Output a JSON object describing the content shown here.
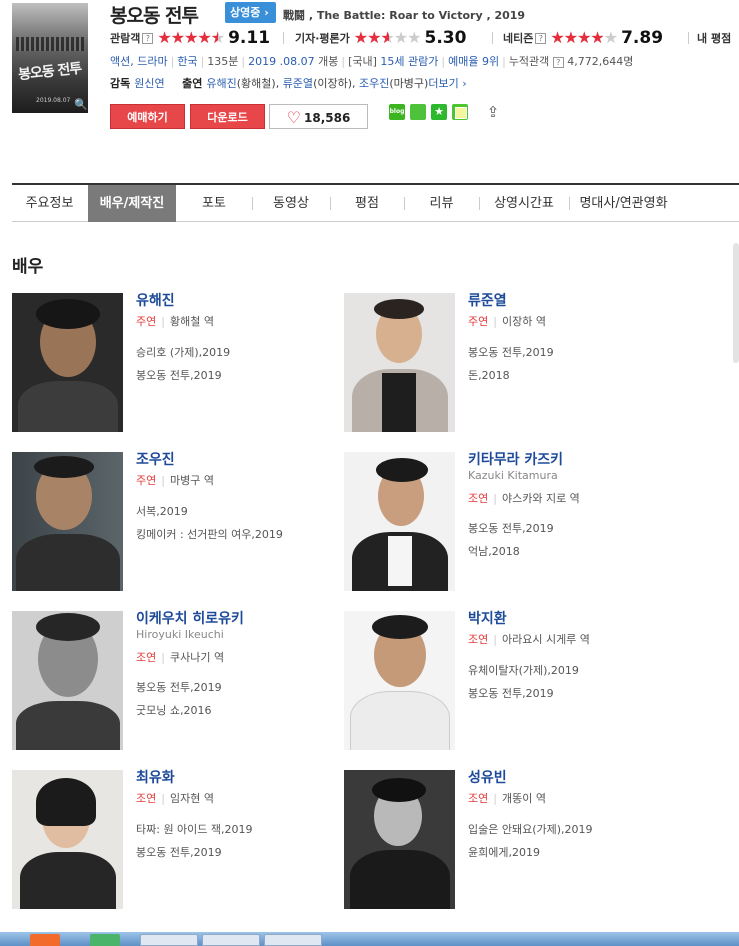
{
  "header": {
    "title": "봉오동 전투",
    "status_badge": "상영중",
    "subtitle": "戰鬪 , The Battle: Roar to Victory , 2019",
    "poster": {
      "title_text": "봉오동 전투",
      "date_text": "2019.08.07"
    },
    "ratings": [
      {
        "label": "관람객",
        "score": "9.11",
        "fill_percent": 91,
        "help": "?"
      },
      {
        "label": "기자·평론가",
        "score": "5.30",
        "fill_percent": 53,
        "help": ""
      },
      {
        "label": "네티즌",
        "score": "7.89",
        "fill_percent": 79,
        "help": "?"
      }
    ],
    "my_rating_label": "내 평점",
    "meta": {
      "genre": "액션, 드라마",
      "country": "한국",
      "runtime": "135분",
      "release_date": "2019 .08.07",
      "release_suffix": "개봉",
      "rating_prefix": "[국내]",
      "rating": "15세 관람가",
      "reservation": "예매율 9위",
      "audience_label": "누적관객",
      "audience_help": "?",
      "audience": "4,772,644명"
    },
    "credits": {
      "director_label": "감독",
      "director": "원신연",
      "cast_label": "출연",
      "cast": [
        {
          "name": "유해진",
          "role": "(황해철)"
        },
        {
          "name": "류준열",
          "role": "(이장하)"
        },
        {
          "name": "조우진",
          "role": "(마병구)"
        }
      ],
      "more_label": "더보기 ›"
    },
    "buttons": {
      "reserve": "예매하기",
      "download": "다운로드",
      "like_count": "18,586"
    },
    "sns": {
      "blog_label": "blog"
    }
  },
  "tabs": [
    {
      "label": "주요정보",
      "active": false
    },
    {
      "label": "배우/제작진",
      "active": true
    },
    {
      "label": "포토",
      "active": false
    },
    {
      "label": "동영상",
      "active": false
    },
    {
      "label": "평점",
      "active": false
    },
    {
      "label": "리뷰",
      "active": false
    },
    {
      "label": "상영시간표",
      "active": false
    },
    {
      "label": "명대사/연관영화",
      "active": false
    }
  ],
  "section_title": "배우",
  "actors": [
    {
      "name": "유해진",
      "eng": "",
      "role_type": "주연",
      "role": "황해철 역",
      "films": [
        "승리호 (가제),2019",
        "봉오동 전투,2019"
      ]
    },
    {
      "name": "류준열",
      "eng": "",
      "role_type": "주연",
      "role": "이장하 역",
      "films": [
        "봉오동 전투,2019",
        "돈,2018"
      ]
    },
    {
      "name": "조우진",
      "eng": "",
      "role_type": "주연",
      "role": "마병구 역",
      "films": [
        "서복,2019",
        "킹메이커 : 선거판의 여우,2019"
      ]
    },
    {
      "name": "키타무라 카즈키",
      "eng": "Kazuki Kitamura",
      "role_type": "조연",
      "role": "야스카와 지로 역",
      "films": [
        "봉오동 전투,2019",
        "억남,2018"
      ]
    },
    {
      "name": "이케우치 히로유키",
      "eng": "Hiroyuki Ikeuchi",
      "role_type": "조연",
      "role": "쿠사나기 역",
      "films": [
        "봉오동 전투,2019",
        "굿모닝 쇼,2016"
      ]
    },
    {
      "name": "박지환",
      "eng": "",
      "role_type": "조연",
      "role": "아라요시 시게루 역",
      "films": [
        "유체이탈자(가제),2019",
        "봉오동 전투,2019"
      ]
    },
    {
      "name": "최유화",
      "eng": "",
      "role_type": "조연",
      "role": "임자현 역",
      "films": [
        "타짜: 원 아이드 잭,2019",
        "봉오동 전투,2019"
      ]
    },
    {
      "name": "성유빈",
      "eng": "",
      "role_type": "조연",
      "role": "개똥이 역",
      "films": [
        "입술은 안돼요(가제),2019",
        "윤희에게,2019"
      ]
    }
  ],
  "colors": {
    "link": "#1d4a99",
    "accent_red": "#e62e3d",
    "badge_blue": "#3a8fd9",
    "tab_active": "#7a7a7a"
  }
}
